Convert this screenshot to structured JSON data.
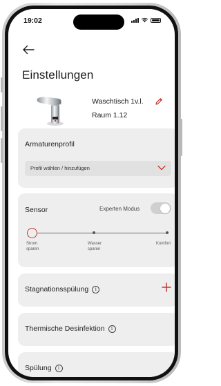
{
  "status_bar": {
    "time": "19:02"
  },
  "header": {
    "title": "Einstellungen"
  },
  "device": {
    "name": "Waschtisch 1v.l.",
    "room": "Raum 1.12"
  },
  "armaturenprofil": {
    "label": "Armaturenprofil",
    "select_value": "Profil wählen / hinzufügen"
  },
  "sensor": {
    "label": "Sensor",
    "expert_mode_label": "Experten Modus",
    "expert_mode_on": false,
    "steps": [
      {
        "line1": "Strom",
        "line2": "sparen"
      },
      {
        "line1": "Wasser",
        "line2": "sparen"
      },
      {
        "line1": "Komfort",
        "line2": ""
      }
    ],
    "selected_step": 0
  },
  "sections": [
    {
      "label": "Stagnationsspülung"
    },
    {
      "label": "Thermische Desinfektion"
    },
    {
      "label": "Spülung"
    }
  ],
  "colors": {
    "accent": "#c0392b",
    "card": "#efeeee",
    "select": "#e2e1e1"
  }
}
